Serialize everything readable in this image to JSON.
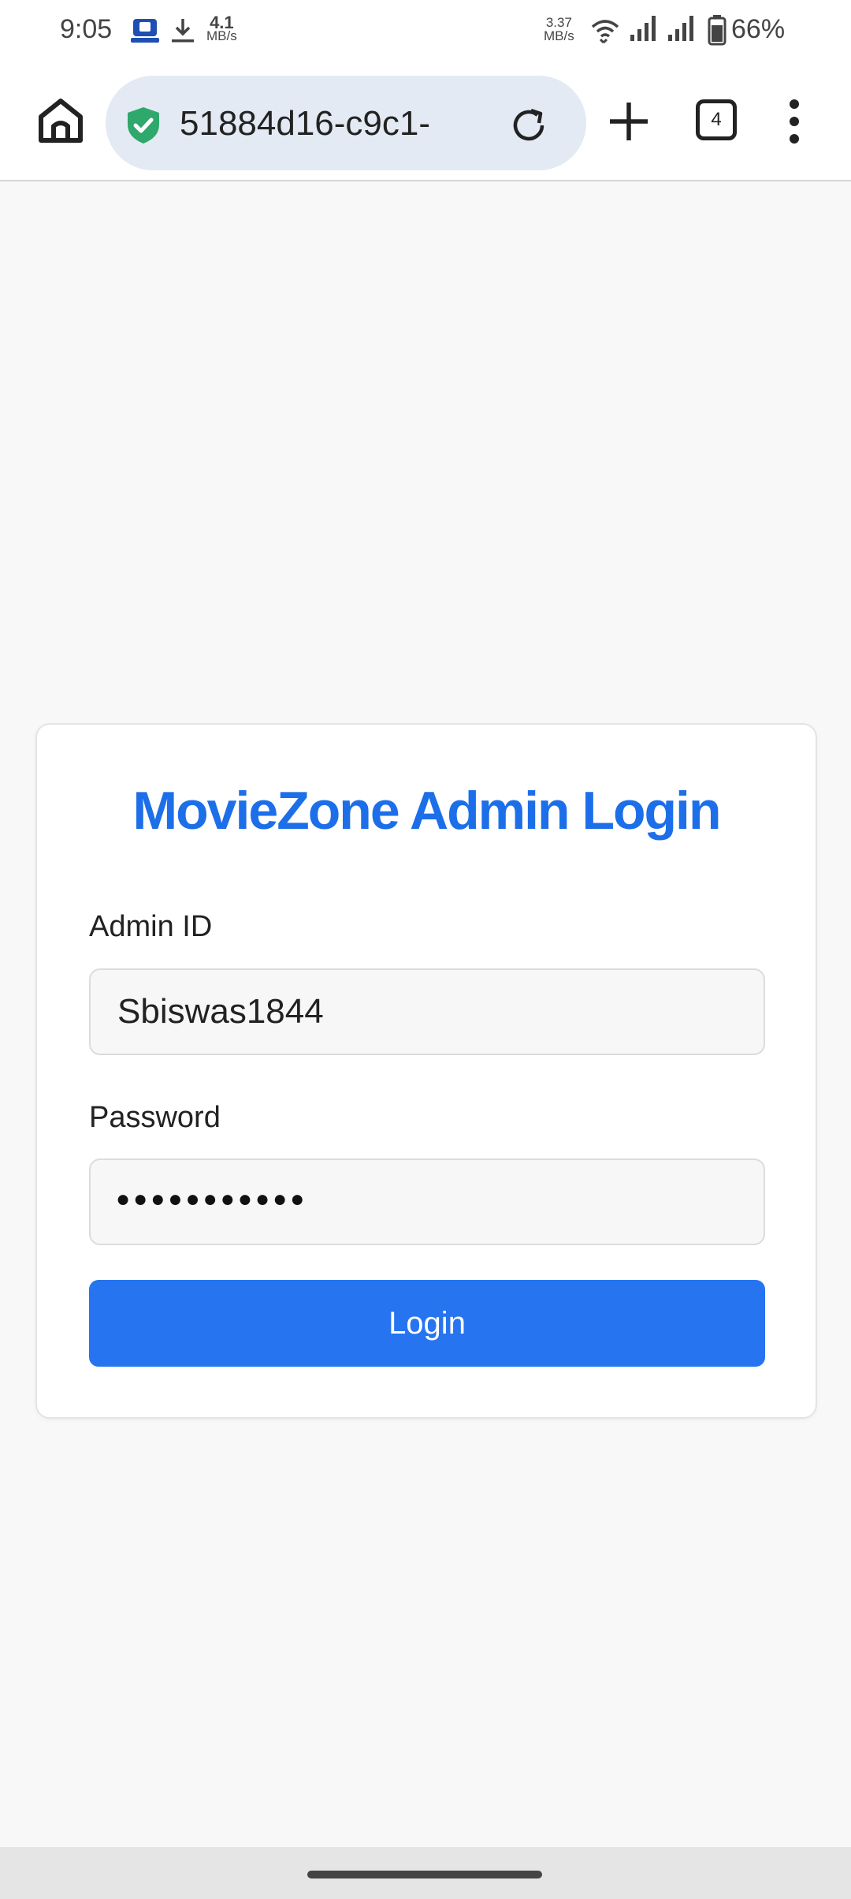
{
  "status_bar": {
    "time": "9:05",
    "download_speed_value": "4.1",
    "download_speed_unit": "MB/s",
    "net_speed_value": "3.37",
    "net_speed_unit": "MB/s",
    "battery_percent": "66%",
    "icons": [
      "notification-app-icon",
      "download-icon",
      "wifi-icon",
      "signal-icon",
      "signal-icon",
      "battery-icon"
    ]
  },
  "browser": {
    "url": "51884d16-c9c1-…",
    "tab_count": "4",
    "secure_color": "#2ea86b"
  },
  "login": {
    "title": "MovieZone Admin Login",
    "admin_id_label": "Admin ID",
    "admin_id_value": "Sbiswas1844",
    "password_label": "Password",
    "password_masked": "●●●●●●●●●●●",
    "login_button": "Login",
    "accent_color": "#2674f0"
  }
}
